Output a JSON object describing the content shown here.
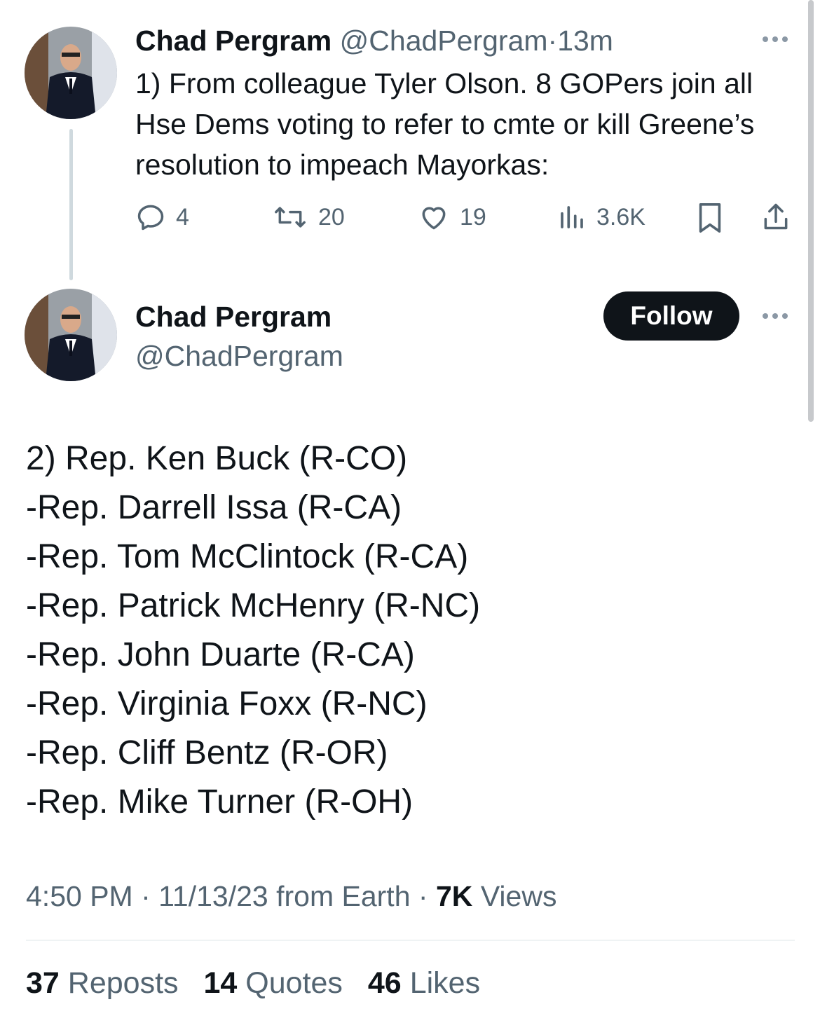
{
  "tweet1": {
    "name": "Chad Pergram",
    "handle": "@ChadPergram",
    "separator": "·",
    "time": "13m",
    "text": "1) From colleague Tyler Olson. 8 GOPers join all Hse Dems voting to refer to cmte or kill Greene’s resolution to impeach Mayorkas:",
    "actions": {
      "reply_count": "4",
      "repost_count": "20",
      "like_count": "19",
      "view_count": "3.6K"
    }
  },
  "tweet2": {
    "name": "Chad Pergram",
    "handle": "@ChadPergram",
    "follow_label": "Follow",
    "lines": [
      "2) Rep. Ken Buck (R-CO)",
      "-Rep. Darrell Issa (R-CA)",
      "-Rep. Tom McClintock (R-CA)",
      "-Rep. Patrick McHenry (R-NC)",
      "-Rep. John Duarte (R-CA)",
      "-Rep. Virginia Foxx (R-NC)",
      "-Rep. Cliff Bentz (R-OR)",
      "-Rep. Mike Turner (R-OH)"
    ],
    "meta": {
      "time": "4:50 PM",
      "sep1": "·",
      "date_source": "11/13/23 from Earth",
      "sep2": "·",
      "views_count": "7K",
      "views_label": "Views"
    },
    "stats": {
      "reposts_count": "37",
      "reposts_label": "Reposts",
      "quotes_count": "14",
      "quotes_label": "Quotes",
      "likes_count": "46",
      "likes_label": "Likes"
    }
  },
  "icons": {
    "reply": "reply-icon",
    "repost": "repost-icon",
    "like": "like-icon",
    "views": "views-icon",
    "bookmark": "bookmark-icon",
    "share": "share-icon",
    "more": "more-icon"
  },
  "colors": {
    "text": "#0f1419",
    "muted": "#536471",
    "thread_line": "#cfd9de",
    "follow_bg": "#0f1419"
  }
}
